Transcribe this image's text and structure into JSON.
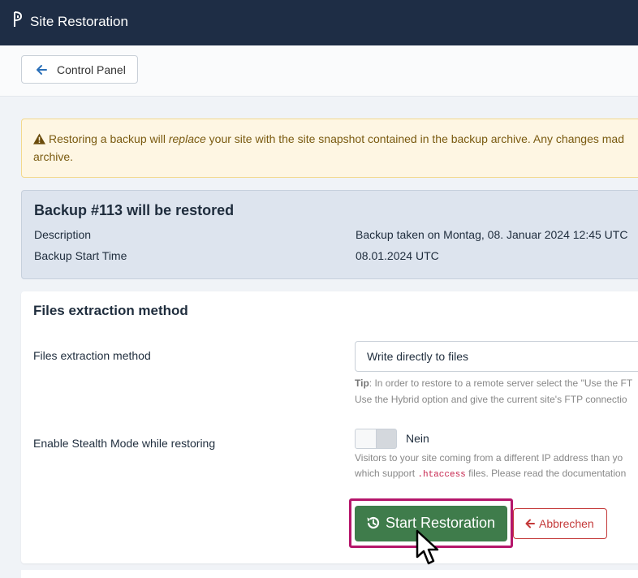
{
  "header": {
    "title": "Site Restoration",
    "logo_icon": "akeeba-logo-icon"
  },
  "toolbar": {
    "control_panel_label": "Control Panel"
  },
  "warning": {
    "line1_pre": "Restoring a backup will ",
    "line1_em": "replace",
    "line1_post": " your site with the site snapshot contained in the backup archive. Any changes mad",
    "line2": "archive."
  },
  "backup": {
    "heading": "Backup #113 will be restored",
    "description_label": "Description",
    "description_value": "Backup taken on Montag, 08. Januar 2024 12:45 UTC",
    "start_time_label": "Backup Start Time",
    "start_time_value": "08.01.2024 UTC"
  },
  "extraction": {
    "heading": "Files extraction method",
    "method_label": "Files extraction method",
    "method_value": "Write directly to files",
    "tip_bold": "Tip",
    "tip_line1": ": In order to restore to a remote server select the \"Use the FT",
    "tip_line2": "Use the Hybrid option and give the current site's FTP connectio",
    "stealth_label": "Enable Stealth Mode while restoring",
    "stealth_state": "Nein",
    "stealth_help1": "Visitors to your site coming from a different IP address than yo",
    "stealth_help2_pre": "which support ",
    "stealth_help2_code": ".htaccess",
    "stealth_help2_post": " files. Please read the documentation "
  },
  "actions": {
    "start_label": "Start Restoration",
    "cancel_label": "Abbrechen"
  },
  "colors": {
    "header_bg": "#1e2d45",
    "start_button": "#3f7c4b",
    "cancel_button": "#c43a3a",
    "highlight_border": "#b5166b"
  }
}
